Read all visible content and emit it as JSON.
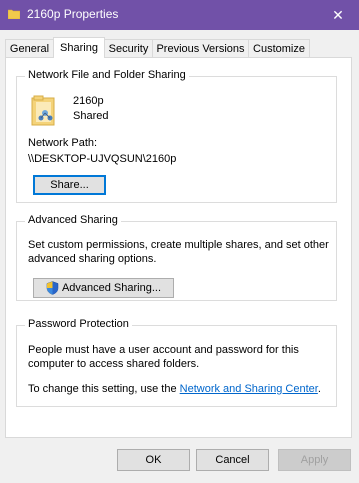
{
  "window": {
    "title": "2160p Properties",
    "close_glyph": "✕"
  },
  "tabs": [
    {
      "label": "General"
    },
    {
      "label": "Sharing"
    },
    {
      "label": "Security"
    },
    {
      "label": "Previous Versions"
    },
    {
      "label": "Customize"
    }
  ],
  "network_sharing": {
    "group_title": "Network File and Folder Sharing",
    "folder_name": "2160p",
    "status": "Shared",
    "path_label": "Network Path:",
    "path_value": "\\\\DESKTOP-UJVQSUN\\2160p",
    "share_button": "Share..."
  },
  "advanced_sharing": {
    "group_title": "Advanced Sharing",
    "description": "Set custom permissions, create multiple shares, and set other advanced sharing options.",
    "button_label": "Advanced Sharing..."
  },
  "password_protection": {
    "group_title": "Password Protection",
    "description": "People must have a user account and password for this computer to access shared folders.",
    "change_text": "To change this setting, use the ",
    "link_text": "Network and Sharing Center",
    "link_suffix": "."
  },
  "footer": {
    "ok": "OK",
    "cancel": "Cancel",
    "apply": "Apply"
  },
  "colors": {
    "titlebar": "#7151a8",
    "link": "#0066cc",
    "focus": "#0078d7"
  }
}
